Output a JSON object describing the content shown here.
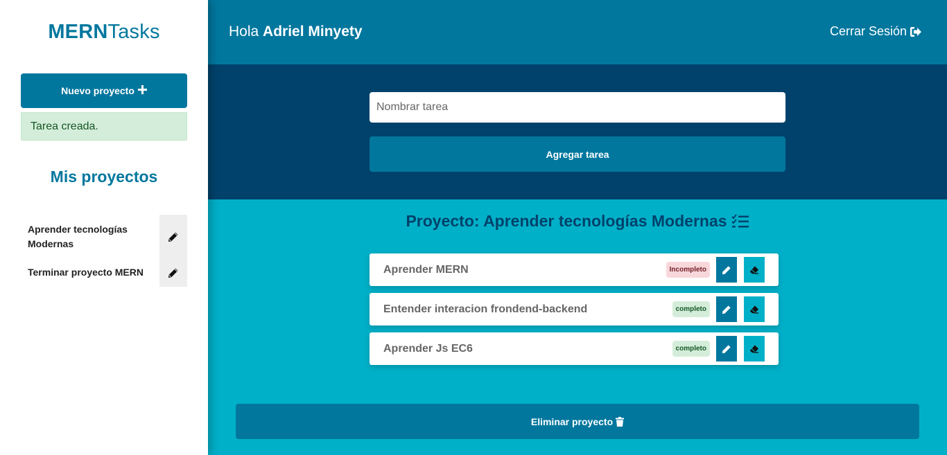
{
  "sidebar": {
    "logo_strong": "MERN",
    "logo_light": "Tasks",
    "new_project_label": "Nuevo proyecto",
    "alert_text": "Tarea creada.",
    "projects_title": "Mis proyectos",
    "projects": [
      {
        "name": "Aprender tecnologías Modernas"
      },
      {
        "name": "Terminar proyecto MERN"
      }
    ]
  },
  "header": {
    "greeting_prefix": "Hola",
    "user_name": "Adriel Minyety",
    "logout_label": "Cerrar Sesión"
  },
  "form": {
    "placeholder": "Nombrar tarea",
    "submit_label": "Agregar tarea"
  },
  "project": {
    "title": "Proyecto: Aprender tecnologías Modernas",
    "tasks": [
      {
        "name": "Aprender MERN",
        "status": "Incompleto"
      },
      {
        "name": "Entender interacion frondend-backend",
        "status": "completo"
      },
      {
        "name": "Aprender Js EC6",
        "status": "completo"
      }
    ],
    "delete_label": "Eliminar proyecto"
  },
  "colors": {
    "primary": "#02779e",
    "dark": "#00426b",
    "accent": "#00b0c8"
  }
}
